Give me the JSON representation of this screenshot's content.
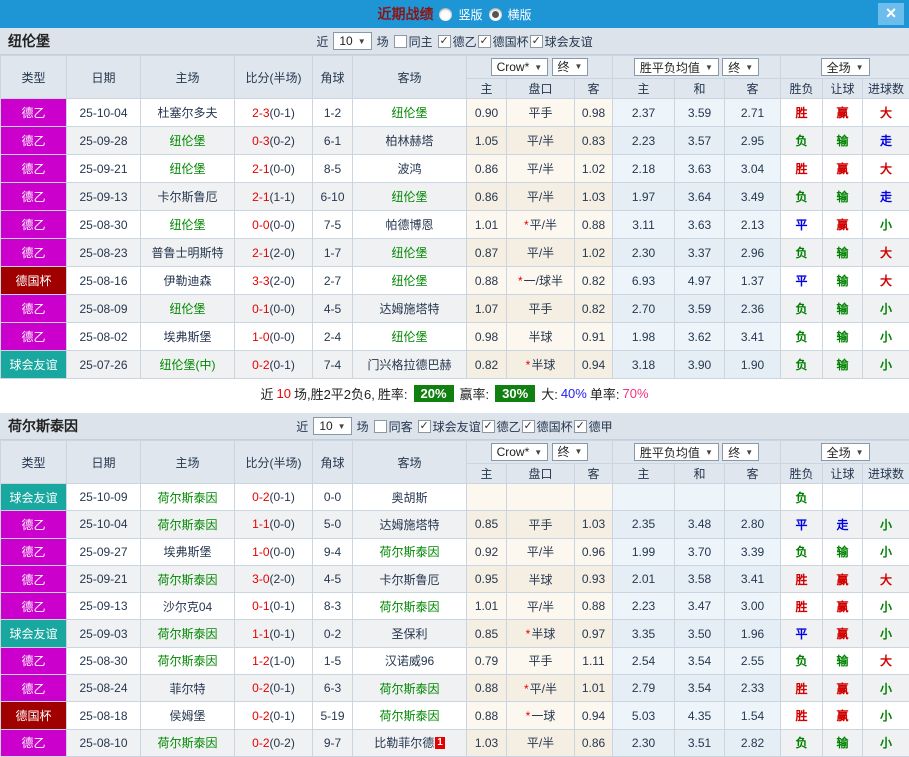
{
  "titlebar": {
    "title": "近期战绩",
    "option_vertical": "竖版",
    "option_horizontal": "横版",
    "selected_option": "横版",
    "close": "×"
  },
  "columns": {
    "type": "类型",
    "date": "日期",
    "home": "主场",
    "score": "比分(半场)",
    "corner": "角球",
    "away": "客场",
    "odds_home": "主",
    "odds_line": "盘口",
    "odds_away": "客",
    "eu_home": "主",
    "eu_draw": "和",
    "eu_away": "客",
    "res_wdl": "胜负",
    "res_handicap": "让球",
    "res_goals": "进球数",
    "select_crow": "Crow*",
    "select_final": "终",
    "select_wdl_avg": "胜平负均值",
    "select_fulltime": "全场"
  },
  "colors": {
    "accent_blue": "#1E96D6",
    "league2": "#CC00CC",
    "cup": "#A00000",
    "friendly": "#19A8A0",
    "win_red": "#D10000",
    "lose_green": "#008000",
    "draw_blue": "#0000E6",
    "focus_team_green": "#008800",
    "score_red": "#E80000",
    "summary_green_bg": "#108010"
  },
  "sections": [
    {
      "team": "纽伦堡",
      "filters": {
        "prefix": "近",
        "count": "10",
        "suffix": "场",
        "mutual_label": "同主",
        "mutual_checked": false,
        "leagues": [
          "德乙",
          "德国杯",
          "球会友谊"
        ]
      },
      "rows": [
        {
          "type": "德乙",
          "type_key": "league2",
          "date": "25-10-04",
          "home": "杜塞尔多夫",
          "home_focus": false,
          "ft": "2-3",
          "ht": "(0-1)",
          "corner": "1-2",
          "away": "纽伦堡",
          "away_focus": true,
          "card": "",
          "o_home": "0.90",
          "line": "平手",
          "line_star": false,
          "o_away": "0.98",
          "e_home": "2.37",
          "e_draw": "3.59",
          "e_away": "2.71",
          "r_wdl": "胜",
          "r_let": "赢",
          "r_goal": "大"
        },
        {
          "type": "德乙",
          "type_key": "league2",
          "date": "25-09-28",
          "home": "纽伦堡",
          "home_focus": true,
          "ft": "0-3",
          "ht": "(0-2)",
          "corner": "6-1",
          "away": "柏林赫塔",
          "away_focus": false,
          "card": "",
          "o_home": "1.05",
          "line": "平/半",
          "line_star": false,
          "o_away": "0.83",
          "e_home": "2.23",
          "e_draw": "3.57",
          "e_away": "2.95",
          "r_wdl": "负",
          "r_let": "输",
          "r_goal": "走"
        },
        {
          "type": "德乙",
          "type_key": "league2",
          "date": "25-09-21",
          "home": "纽伦堡",
          "home_focus": true,
          "ft": "2-1",
          "ht": "(0-0)",
          "corner": "8-5",
          "away": "波鸿",
          "away_focus": false,
          "card": "",
          "o_home": "0.86",
          "line": "平/半",
          "line_star": false,
          "o_away": "1.02",
          "e_home": "2.18",
          "e_draw": "3.63",
          "e_away": "3.04",
          "r_wdl": "胜",
          "r_let": "赢",
          "r_goal": "大"
        },
        {
          "type": "德乙",
          "type_key": "league2",
          "date": "25-09-13",
          "home": "卡尔斯鲁厄",
          "home_focus": false,
          "ft": "2-1",
          "ht": "(1-1)",
          "corner": "6-10",
          "away": "纽伦堡",
          "away_focus": true,
          "card": "",
          "o_home": "0.86",
          "line": "平/半",
          "line_star": false,
          "o_away": "1.03",
          "e_home": "1.97",
          "e_draw": "3.64",
          "e_away": "3.49",
          "r_wdl": "负",
          "r_let": "输",
          "r_goal": "走"
        },
        {
          "type": "德乙",
          "type_key": "league2",
          "date": "25-08-30",
          "home": "纽伦堡",
          "home_focus": true,
          "ft": "0-0",
          "ht": "(0-0)",
          "corner": "7-5",
          "away": "帕德博恩",
          "away_focus": false,
          "card": "",
          "o_home": "1.01",
          "line": "平/半",
          "line_star": true,
          "o_away": "0.88",
          "e_home": "3.11",
          "e_draw": "3.63",
          "e_away": "2.13",
          "r_wdl": "平",
          "r_let": "赢",
          "r_goal": "小"
        },
        {
          "type": "德乙",
          "type_key": "league2",
          "date": "25-08-23",
          "home": "普鲁士明斯特",
          "home_focus": false,
          "ft": "2-1",
          "ht": "(2-0)",
          "corner": "1-7",
          "away": "纽伦堡",
          "away_focus": true,
          "card": "",
          "o_home": "0.87",
          "line": "平/半",
          "line_star": false,
          "o_away": "1.02",
          "e_home": "2.30",
          "e_draw": "3.37",
          "e_away": "2.96",
          "r_wdl": "负",
          "r_let": "输",
          "r_goal": "大"
        },
        {
          "type": "德国杯",
          "type_key": "cup",
          "date": "25-08-16",
          "home": "伊勒迪森",
          "home_focus": false,
          "ft": "3-3",
          "ht": "(2-0)",
          "corner": "2-7",
          "away": "纽伦堡",
          "away_focus": true,
          "card": "",
          "o_home": "0.88",
          "line": "一/球半",
          "line_star": true,
          "o_away": "0.82",
          "e_home": "6.93",
          "e_draw": "4.97",
          "e_away": "1.37",
          "r_wdl": "平",
          "r_let": "输",
          "r_goal": "大"
        },
        {
          "type": "德乙",
          "type_key": "league2",
          "date": "25-08-09",
          "home": "纽伦堡",
          "home_focus": true,
          "ft": "0-1",
          "ht": "(0-0)",
          "corner": "4-5",
          "away": "达姆施塔特",
          "away_focus": false,
          "card": "",
          "o_home": "1.07",
          "line": "平手",
          "line_star": false,
          "o_away": "0.82",
          "e_home": "2.70",
          "e_draw": "3.59",
          "e_away": "2.36",
          "r_wdl": "负",
          "r_let": "输",
          "r_goal": "小"
        },
        {
          "type": "德乙",
          "type_key": "league2",
          "date": "25-08-02",
          "home": "埃弗斯堡",
          "home_focus": false,
          "ft": "1-0",
          "ht": "(0-0)",
          "corner": "2-4",
          "away": "纽伦堡",
          "away_focus": true,
          "card": "",
          "o_home": "0.98",
          "line": "半球",
          "line_star": false,
          "o_away": "0.91",
          "e_home": "1.98",
          "e_draw": "3.62",
          "e_away": "3.41",
          "r_wdl": "负",
          "r_let": "输",
          "r_goal": "小"
        },
        {
          "type": "球会友谊",
          "type_key": "friendly",
          "date": "25-07-26",
          "home": "纽伦堡(中)",
          "home_focus": true,
          "ft": "0-2",
          "ht": "(0-1)",
          "corner": "7-4",
          "away": "门兴格拉德巴赫",
          "away_focus": false,
          "card": "",
          "o_home": "0.82",
          "line": "半球",
          "line_star": true,
          "o_away": "0.94",
          "e_home": "3.18",
          "e_draw": "3.90",
          "e_away": "1.90",
          "r_wdl": "负",
          "r_let": "输",
          "r_goal": "小"
        }
      ],
      "summary": {
        "prefix": "近",
        "count": "10",
        "text1": "场,胜2平2负6,",
        "rate1_label": "胜率:",
        "rate1": "20%",
        "rate2_label": "赢率:",
        "rate2": "30%",
        "big_label": "大:",
        "big": "40%",
        "single_label": "单率:",
        "single": "70%"
      }
    },
    {
      "team": "荷尔斯泰因",
      "filters": {
        "prefix": "近",
        "count": "10",
        "suffix": "场",
        "mutual_label": "同客",
        "mutual_checked": false,
        "leagues": [
          "球会友谊",
          "德乙",
          "德国杯",
          "德甲"
        ]
      },
      "rows": [
        {
          "type": "球会友谊",
          "type_key": "friendly",
          "date": "25-10-09",
          "home": "荷尔斯泰因",
          "home_focus": true,
          "ft": "0-2",
          "ht": "(0-1)",
          "corner": "0-0",
          "away": "奥胡斯",
          "away_focus": false,
          "card": "",
          "o_home": "",
          "line": "",
          "line_star": false,
          "o_away": "",
          "e_home": "",
          "e_draw": "",
          "e_away": "",
          "r_wdl": "负",
          "r_let": "",
          "r_goal": ""
        },
        {
          "type": "德乙",
          "type_key": "league2",
          "date": "25-10-04",
          "home": "荷尔斯泰因",
          "home_focus": true,
          "ft": "1-1",
          "ht": "(0-0)",
          "corner": "5-0",
          "away": "达姆施塔特",
          "away_focus": false,
          "card": "",
          "o_home": "0.85",
          "line": "平手",
          "line_star": false,
          "o_away": "1.03",
          "e_home": "2.35",
          "e_draw": "3.48",
          "e_away": "2.80",
          "r_wdl": "平",
          "r_let": "走",
          "r_goal": "小"
        },
        {
          "type": "德乙",
          "type_key": "league2",
          "date": "25-09-27",
          "home": "埃弗斯堡",
          "home_focus": false,
          "ft": "1-0",
          "ht": "(0-0)",
          "corner": "9-4",
          "away": "荷尔斯泰因",
          "away_focus": true,
          "card": "",
          "o_home": "0.92",
          "line": "平/半",
          "line_star": false,
          "o_away": "0.96",
          "e_home": "1.99",
          "e_draw": "3.70",
          "e_away": "3.39",
          "r_wdl": "负",
          "r_let": "输",
          "r_goal": "小"
        },
        {
          "type": "德乙",
          "type_key": "league2",
          "date": "25-09-21",
          "home": "荷尔斯泰因",
          "home_focus": true,
          "ft": "3-0",
          "ht": "(2-0)",
          "corner": "4-5",
          "away": "卡尔斯鲁厄",
          "away_focus": false,
          "card": "",
          "o_home": "0.95",
          "line": "半球",
          "line_star": false,
          "o_away": "0.93",
          "e_home": "2.01",
          "e_draw": "3.58",
          "e_away": "3.41",
          "r_wdl": "胜",
          "r_let": "赢",
          "r_goal": "大"
        },
        {
          "type": "德乙",
          "type_key": "league2",
          "date": "25-09-13",
          "home": "沙尔克04",
          "home_focus": false,
          "ft": "0-1",
          "ht": "(0-1)",
          "corner": "8-3",
          "away": "荷尔斯泰因",
          "away_focus": true,
          "card": "",
          "o_home": "1.01",
          "line": "平/半",
          "line_star": false,
          "o_away": "0.88",
          "e_home": "2.23",
          "e_draw": "3.47",
          "e_away": "3.00",
          "r_wdl": "胜",
          "r_let": "赢",
          "r_goal": "小"
        },
        {
          "type": "球会友谊",
          "type_key": "friendly",
          "date": "25-09-03",
          "home": "荷尔斯泰因",
          "home_focus": true,
          "ft": "1-1",
          "ht": "(0-1)",
          "corner": "0-2",
          "away": "圣保利",
          "away_focus": false,
          "card": "",
          "o_home": "0.85",
          "line": "半球",
          "line_star": true,
          "o_away": "0.97",
          "e_home": "3.35",
          "e_draw": "3.50",
          "e_away": "1.96",
          "r_wdl": "平",
          "r_let": "赢",
          "r_goal": "小"
        },
        {
          "type": "德乙",
          "type_key": "league2",
          "date": "25-08-30",
          "home": "荷尔斯泰因",
          "home_focus": true,
          "ft": "1-2",
          "ht": "(1-0)",
          "corner": "1-5",
          "away": "汉诺威96",
          "away_focus": false,
          "card": "",
          "o_home": "0.79",
          "line": "平手",
          "line_star": false,
          "o_away": "1.11",
          "e_home": "2.54",
          "e_draw": "3.54",
          "e_away": "2.55",
          "r_wdl": "负",
          "r_let": "输",
          "r_goal": "大"
        },
        {
          "type": "德乙",
          "type_key": "league2",
          "date": "25-08-24",
          "home": "菲尔特",
          "home_focus": false,
          "ft": "0-2",
          "ht": "(0-1)",
          "corner": "6-3",
          "away": "荷尔斯泰因",
          "away_focus": true,
          "card": "",
          "o_home": "0.88",
          "line": "平/半",
          "line_star": true,
          "o_away": "1.01",
          "e_home": "2.79",
          "e_draw": "3.54",
          "e_away": "2.33",
          "r_wdl": "胜",
          "r_let": "赢",
          "r_goal": "小"
        },
        {
          "type": "德国杯",
          "type_key": "cup",
          "date": "25-08-18",
          "home": "侯姆堡",
          "home_focus": false,
          "ft": "0-2",
          "ht": "(0-1)",
          "corner": "5-19",
          "away": "荷尔斯泰因",
          "away_focus": true,
          "card": "",
          "o_home": "0.88",
          "line": "一球",
          "line_star": true,
          "o_away": "0.94",
          "e_home": "5.03",
          "e_draw": "4.35",
          "e_away": "1.54",
          "r_wdl": "胜",
          "r_let": "赢",
          "r_goal": "小"
        },
        {
          "type": "德乙",
          "type_key": "league2",
          "date": "25-08-10",
          "home": "荷尔斯泰因",
          "home_focus": true,
          "ft": "0-2",
          "ht": "(0-2)",
          "corner": "9-7",
          "away": "比勒菲尔德",
          "away_focus": false,
          "card": "1",
          "o_home": "1.03",
          "line": "平/半",
          "line_star": false,
          "o_away": "0.86",
          "e_home": "2.30",
          "e_draw": "3.51",
          "e_away": "2.82",
          "r_wdl": "负",
          "r_let": "输",
          "r_goal": "小"
        }
      ]
    }
  ]
}
